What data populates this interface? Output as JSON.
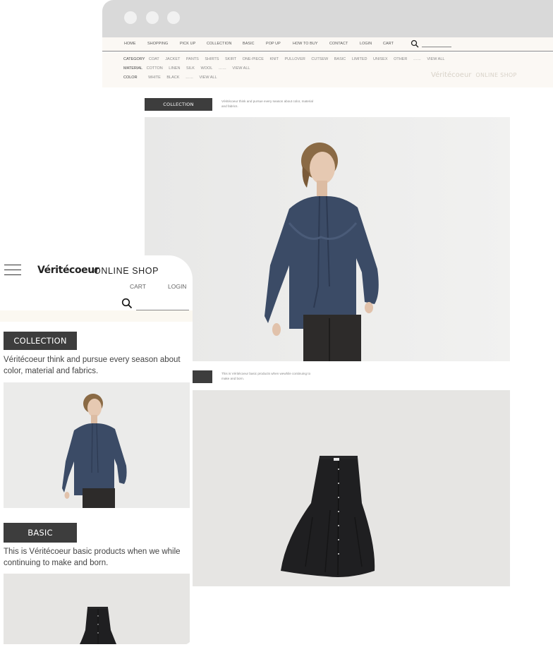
{
  "desktop": {
    "nav": [
      {
        "label": "HOME",
        "name": "nav-home"
      },
      {
        "label": "SHOPPING",
        "name": "nav-shopping"
      },
      {
        "label": "PICK UP",
        "name": "nav-pickup"
      },
      {
        "label": "COLLECTION",
        "name": "nav-collection"
      },
      {
        "label": "BASIC",
        "name": "nav-basic"
      },
      {
        "label": "POP UP",
        "name": "nav-popup"
      },
      {
        "label": "HOW TO BUY",
        "name": "nav-howtobuy"
      },
      {
        "label": "CONTACT",
        "name": "nav-contact"
      },
      {
        "label": "LOGIN",
        "name": "nav-login"
      },
      {
        "label": "CART",
        "name": "nav-cart"
      }
    ],
    "search_icon": "search-icon",
    "category": {
      "label": "CATEGORY",
      "options": [
        "COAT",
        "JACKET",
        "PANTS",
        "SHIRTS",
        "SKIRT",
        "ONE-PIECE",
        "KNIT",
        "PULLOVER",
        "CUTSEW",
        "BASIC",
        "LIMITED",
        "UNISEX",
        "OTHER",
        "……",
        "VIEW ALL"
      ]
    },
    "material": {
      "label": "MATERIAL",
      "options": [
        "COTTON",
        "LINEN",
        "SILK",
        "WOOL",
        "……",
        "VIEW ALL"
      ]
    },
    "color": {
      "label": "COLOR",
      "options": [
        "WHITE",
        "BLACK",
        "……",
        "VIEW ALL"
      ]
    },
    "brand": "Véritécoeur",
    "brand_suffix": "ONLINE SHOP",
    "collection": {
      "label": "COLLECTION",
      "description": "Véritécoeur think and pursue every season about color, material and fabrics."
    },
    "basic": {
      "label": "",
      "description": "This is Véritécoeur basic products when wewhile continuing to make and born."
    }
  },
  "mobile": {
    "brand": "Véritécoeur",
    "brand_suffix": "ONLINE SHOP",
    "cart": "CART",
    "login": "LOGIN",
    "menu_icon": "hamburger-menu-icon",
    "search_icon": "search-icon",
    "collection": {
      "label": "COLLECTION",
      "description": "Véritécoeur think and pursue every season about color, material and fabrics."
    },
    "basic": {
      "label": "BASIC",
      "description": "This is Véritécoeur basic products when we while continuing to make and born."
    }
  },
  "colors": {
    "titlebar": "#d9d9d9",
    "header_bg": "#fbf8f4",
    "button_bg": "#3d3d3d",
    "photo_bg": "#ebebea"
  }
}
